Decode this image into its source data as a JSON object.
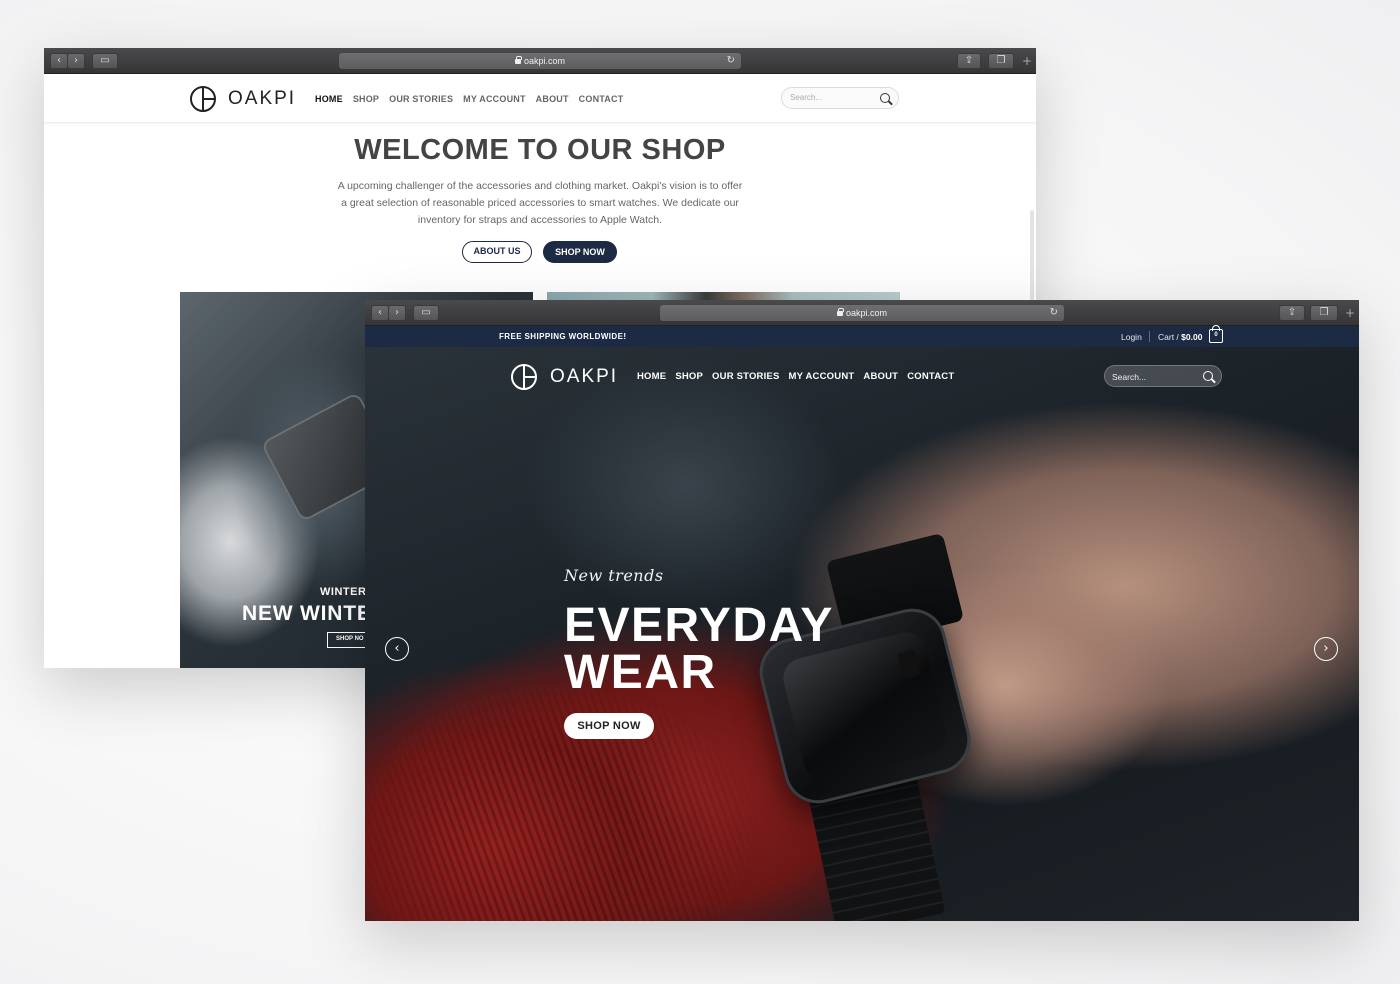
{
  "window_back": {
    "url": "oakpi.com",
    "logo": "OAKPI",
    "nav": [
      "HOME",
      "SHOP",
      "OUR STORIES",
      "MY ACCOUNT",
      "ABOUT",
      "CONTACT"
    ],
    "search_placeholder": "Search...",
    "welcome_title": "WELCOME TO OUR SHOP",
    "intro_lines": [
      "A upcoming challenger of the accessories and clothing market. Oakpi's vision is to offer",
      "a great selection of reasonable priced accessories to smart watches. We dedicate our",
      "inventory for straps and accessories to Apple Watch."
    ],
    "about_button": "ABOUT US",
    "shop_button": "SHOP NOW",
    "panel": {
      "kicker": "WINTER",
      "title": "NEW WINTE",
      "button": "SHOP NO"
    }
  },
  "window_front": {
    "url": "oakpi.com",
    "topbar": {
      "shipping": "FREE SHIPPING WORLDWIDE!",
      "login": "Login",
      "cart_label": "Cart / ",
      "cart_total": "$0.00",
      "cart_count": "0"
    },
    "logo": "OAKPI",
    "nav": [
      "HOME",
      "SHOP",
      "OUR STORIES",
      "MY ACCOUNT",
      "ABOUT",
      "CONTACT"
    ],
    "search_placeholder": "Search...",
    "hero": {
      "tagline": "New trends",
      "headline_line1": "EVERYDAY",
      "headline_line2": "WEAR",
      "button": "SHOP NOW",
      "slides_total": 2,
      "slide_active": 2
    }
  },
  "colors": {
    "navy": "#1c2a44",
    "text_dark": "#444444",
    "accent_white": "#ffffff"
  },
  "icons": [
    "back-icon",
    "forward-icon",
    "sidebar-icon",
    "lock-icon",
    "reload-icon",
    "share-icon",
    "tabs-icon",
    "new-tab-icon",
    "search-icon",
    "bag-icon",
    "chevron-left-icon",
    "chevron-right-icon"
  ]
}
